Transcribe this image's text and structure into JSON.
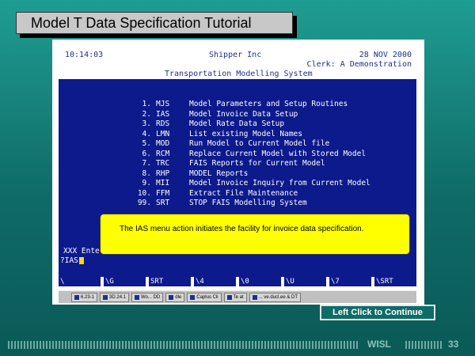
{
  "slide": {
    "title": "Model T Data Specification Tutorial",
    "continue_label": "Left Click to Continue",
    "footer_label": "WISL",
    "page_number": "33"
  },
  "terminal": {
    "time": "10:14:03",
    "company": "Shipper Inc",
    "date": "28 NOV 2000",
    "clerk": "Clerk: A Demonstration",
    "system": "Transportation Modelling System",
    "menu": [
      {
        "num": "1.",
        "code": "MJS",
        "desc": "Model Parameters and Setup Routines"
      },
      {
        "num": "2.",
        "code": "IAS",
        "desc": "Model Invoice Data Setup"
      },
      {
        "num": "3.",
        "code": "RDS",
        "desc": "Model Rate Data Setup"
      },
      {
        "num": "4.",
        "code": "LMN",
        "desc": "List existing Model Names"
      },
      {
        "num": "5.",
        "code": "MOD",
        "desc": "Run Model to Current Model file"
      },
      {
        "num": "6.",
        "code": "RCM",
        "desc": "Replace Current Model with Stored Model"
      },
      {
        "num": "7.",
        "code": "TRC",
        "desc": "FAIS Reports for Current Model"
      },
      {
        "num": "8.",
        "code": "RHP",
        "desc": "MODEL Reports"
      },
      {
        "num": "9.",
        "code": "MII",
        "desc": "Model Invoice Inquiry from Current Model"
      },
      {
        "num": "10.",
        "code": "FFM",
        "desc": "Extract File Maintenance"
      },
      {
        "num": "99.",
        "code": "SRT",
        "desc": "STOP FAIS Modelling System"
      }
    ],
    "cmd_prompt": "XXX Enter",
    "cmd_input": "?IAS",
    "fkeys": [
      "\\",
      "\\G",
      "SRT",
      "\\4",
      "\\0",
      "\\U",
      "\\7",
      "\\SRT"
    ]
  },
  "callout": {
    "text": "The IAS menu action initiates the facility for invoice data specification."
  },
  "taskbar": {
    "items": [
      "6.23-1",
      "3D.24.1",
      "Wo... DD",
      "dle",
      "Caplus Cli",
      "Te at",
      "... ve.ducl.ee & DT"
    ]
  }
}
